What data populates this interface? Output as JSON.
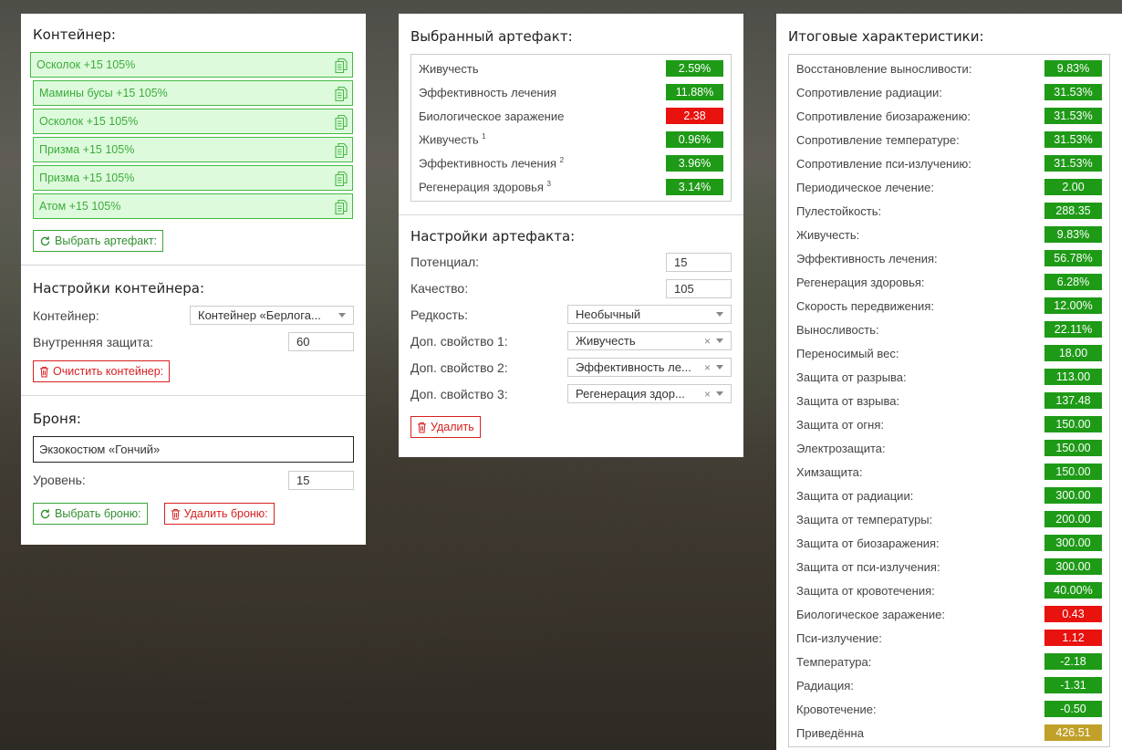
{
  "container_panel": {
    "title": "Контейнер:",
    "items": [
      {
        "label": "Осколок +15 105%"
      },
      {
        "label": "Мамины бусы +15 105%"
      },
      {
        "label": "Осколок +15 105%"
      },
      {
        "label": "Призма +15 105%"
      },
      {
        "label": "Призма +15 105%"
      },
      {
        "label": "Атом +15 105%"
      }
    ],
    "select_artifact_label": "Выбрать артефакт:",
    "settings_title": "Настройки контейнера:",
    "container_label": "Контейнер:",
    "container_value": "Контейнер «Берлога...",
    "protection_label": "Внутренняя защита:",
    "protection_value": "60",
    "clear_label": "Очистить контейнер:",
    "armor_title": "Броня:",
    "armor_value": "Экзокостюм «Гончий»",
    "level_label": "Уровень:",
    "level_value": "15",
    "select_armor_label": "Выбрать броню:",
    "delete_armor_label": "Удалить броню:"
  },
  "artifact_panel": {
    "title": "Выбранный артефакт:",
    "stats": [
      {
        "name": "Живучесть",
        "sup": "",
        "value": "2.59%",
        "color": "green"
      },
      {
        "name": "Эффективность лечения",
        "sup": "",
        "value": "11.88%",
        "color": "green"
      },
      {
        "name": "Биологическое заражение",
        "sup": "",
        "value": "2.38",
        "color": "red"
      },
      {
        "name": "Живучесть",
        "sup": "1",
        "value": "0.96%",
        "color": "green"
      },
      {
        "name": "Эффективность лечения",
        "sup": "2",
        "value": "3.96%",
        "color": "green"
      },
      {
        "name": "Регенерация здоровья",
        "sup": "3",
        "value": "3.14%",
        "color": "green"
      }
    ],
    "settings_title": "Настройки артефакта:",
    "potential_label": "Потенциал:",
    "potential_value": "15",
    "quality_label": "Качество:",
    "quality_value": "105",
    "rarity_label": "Редкость:",
    "rarity_value": "Необычный",
    "extra1_label": "Доп. свойство 1:",
    "extra1_value": "Живучесть",
    "extra2_label": "Доп. свойство 2:",
    "extra2_value": "Эффективность ле...",
    "extra3_label": "Доп. свойство 3:",
    "extra3_value": "Регенерация здор...",
    "delete_label": "Удалить"
  },
  "totals_panel": {
    "title": "Итоговые характеристики:",
    "stats": [
      {
        "name": "Восстановление выносливости:",
        "value": "9.83%",
        "color": "green"
      },
      {
        "name": "Сопротивление радиации:",
        "value": "31.53%",
        "color": "green"
      },
      {
        "name": "Сопротивление биозаражению:",
        "value": "31.53%",
        "color": "green"
      },
      {
        "name": "Сопротивление температуре:",
        "value": "31.53%",
        "color": "green"
      },
      {
        "name": "Сопротивление пси-излучению:",
        "value": "31.53%",
        "color": "green"
      },
      {
        "name": "Периодическое лечение:",
        "value": "2.00",
        "color": "green"
      },
      {
        "name": "Пулестойкость:",
        "value": "288.35",
        "color": "green"
      },
      {
        "name": "Живучесть:",
        "value": "9.83%",
        "color": "green"
      },
      {
        "name": "Эффективность лечения:",
        "value": "56.78%",
        "color": "green"
      },
      {
        "name": "Регенерация здоровья:",
        "value": "6.28%",
        "color": "green"
      },
      {
        "name": "Скорость передвижения:",
        "value": "12.00%",
        "color": "green"
      },
      {
        "name": "Выносливость:",
        "value": "22.11%",
        "color": "green"
      },
      {
        "name": "Переносимый вес:",
        "value": "18.00",
        "color": "green"
      },
      {
        "name": "Защита от разрыва:",
        "value": "113.00",
        "color": "green"
      },
      {
        "name": "Защита от взрыва:",
        "value": "137.48",
        "color": "green"
      },
      {
        "name": "Защита от огня:",
        "value": "150.00",
        "color": "green"
      },
      {
        "name": "Электрозащита:",
        "value": "150.00",
        "color": "green"
      },
      {
        "name": "Химзащита:",
        "value": "150.00",
        "color": "green"
      },
      {
        "name": "Защита от радиации:",
        "value": "300.00",
        "color": "green"
      },
      {
        "name": "Защита от температуры:",
        "value": "200.00",
        "color": "green"
      },
      {
        "name": "Защита от биозаражения:",
        "value": "300.00",
        "color": "green"
      },
      {
        "name": "Защита от пси-излучения:",
        "value": "300.00",
        "color": "green"
      },
      {
        "name": "Защита от кровотечения:",
        "value": "40.00%",
        "color": "green"
      },
      {
        "name": "Биологическое заражение:",
        "value": "0.43",
        "color": "red"
      },
      {
        "name": "Пси-излучение:",
        "value": "1.12",
        "color": "red"
      },
      {
        "name": "Температура:",
        "value": "-2.18",
        "color": "green"
      },
      {
        "name": "Радиация:",
        "value": "-1.31",
        "color": "green"
      },
      {
        "name": "Кровотечение:",
        "value": "-0.50",
        "color": "green"
      },
      {
        "name": "Приведённа",
        "value": "426.51",
        "color": "gold"
      }
    ]
  },
  "colors": {
    "green": "#1e9a17",
    "red": "#e8120f",
    "gold": "#c0a028",
    "item_bg": "#ddfbdc",
    "item_border": "#46b946"
  }
}
